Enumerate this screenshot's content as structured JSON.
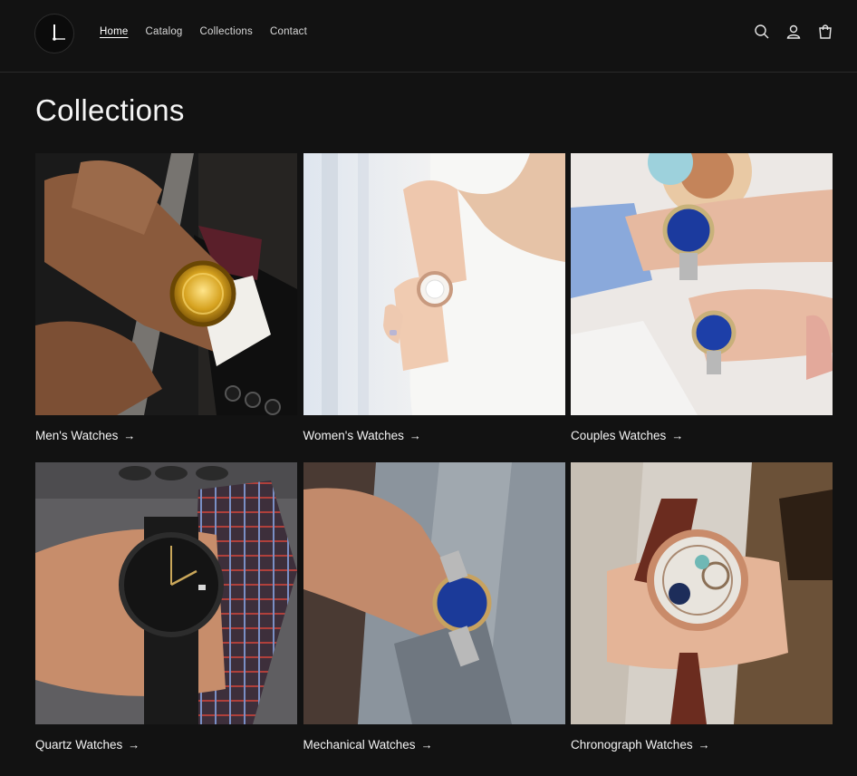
{
  "nav": {
    "items": [
      {
        "label": "Home",
        "active": true
      },
      {
        "label": "Catalog",
        "active": false
      },
      {
        "label": "Collections",
        "active": false
      },
      {
        "label": "Contact",
        "active": false
      }
    ]
  },
  "header_icons": [
    "search-icon",
    "account-icon",
    "cart-icon"
  ],
  "page": {
    "title": "Collections"
  },
  "collections": [
    {
      "label": "Men's Watches",
      "image": "gold-watch-suit"
    },
    {
      "label": "Women's Watches",
      "image": "silver-watch-white-blouse"
    },
    {
      "label": "Couples Watches",
      "image": "blue-dial-pair"
    },
    {
      "label": "Quartz Watches",
      "image": "black-dial-leather"
    },
    {
      "label": "Mechanical Watches",
      "image": "blue-dial-steel"
    },
    {
      "label": "Chronograph Watches",
      "image": "skeleton-rose-gold"
    }
  ],
  "colors": {
    "background": "#121212",
    "text": "#f3f3f3"
  }
}
